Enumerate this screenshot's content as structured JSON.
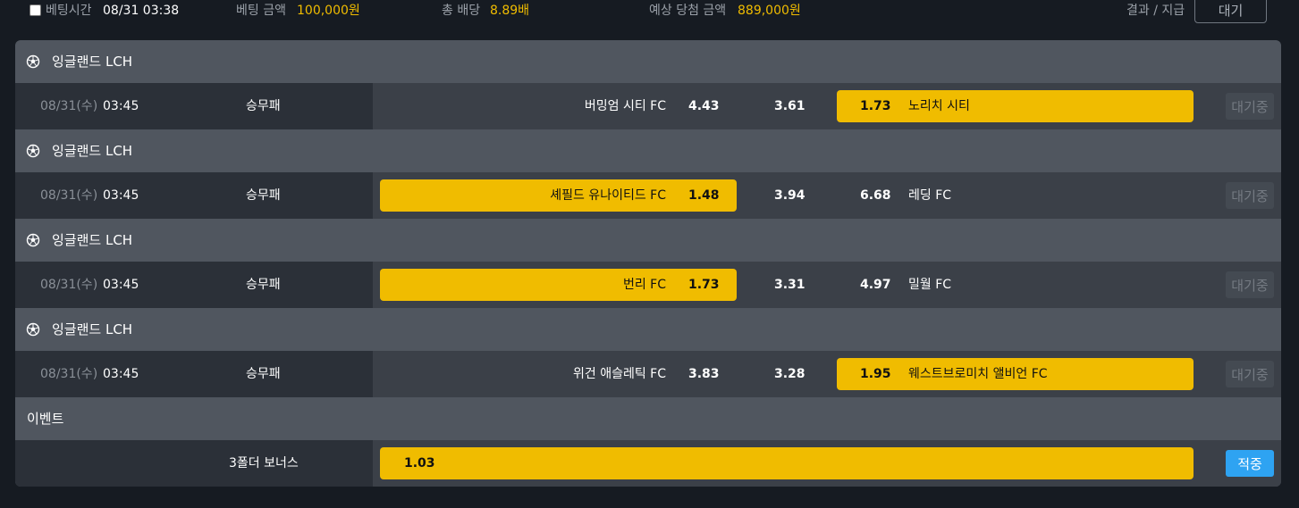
{
  "topbar": {
    "bet_time_label": "베팅시간",
    "bet_time_value": "08/31 03:38",
    "bet_amount_label": "베팅 금액",
    "bet_amount_value": "100,000원",
    "total_odds_label": "총 배당",
    "total_odds_value": "8.89배",
    "expected_win_label": "예상 당첨 금액",
    "expected_win_value": "889,000원",
    "result_label": "결과 / 지급",
    "status_button": "대기"
  },
  "matches": [
    {
      "league": "잉글랜드 LCH",
      "date": "08/31(수)",
      "time": "03:45",
      "market": "승무패",
      "home": "버밍엄 시티 FC",
      "home_odds": "4.43",
      "draw_odds": "3.61",
      "away_odds": "1.73",
      "away": "노리치 시티",
      "selected": "away",
      "status": "대기중"
    },
    {
      "league": "잉글랜드 LCH",
      "date": "08/31(수)",
      "time": "03:45",
      "market": "승무패",
      "home": "셰필드 유나이티드 FC",
      "home_odds": "1.48",
      "draw_odds": "3.94",
      "away_odds": "6.68",
      "away": "레딩 FC",
      "selected": "home",
      "status": "대기중"
    },
    {
      "league": "잉글랜드 LCH",
      "date": "08/31(수)",
      "time": "03:45",
      "market": "승무패",
      "home": "번리 FC",
      "home_odds": "1.73",
      "draw_odds": "3.31",
      "away_odds": "4.97",
      "away": "밀월 FC",
      "selected": "home",
      "status": "대기중"
    },
    {
      "league": "잉글랜드 LCH",
      "date": "08/31(수)",
      "time": "03:45",
      "market": "승무패",
      "home": "위건 애슬레틱 FC",
      "home_odds": "3.83",
      "draw_odds": "3.28",
      "away_odds": "1.95",
      "away": "웨스트브로미치 앨비언 FC",
      "selected": "away",
      "status": "대기중"
    }
  ],
  "event": {
    "title": "이벤트",
    "name": "3폴더 보너스",
    "odds": "1.03",
    "status": "적중"
  },
  "colors": {
    "highlight": "#f0bc00",
    "hit_badge": "#2ea3f2",
    "panel": "#50565f"
  },
  "icons": {
    "league": "soccer-ball-icon"
  }
}
